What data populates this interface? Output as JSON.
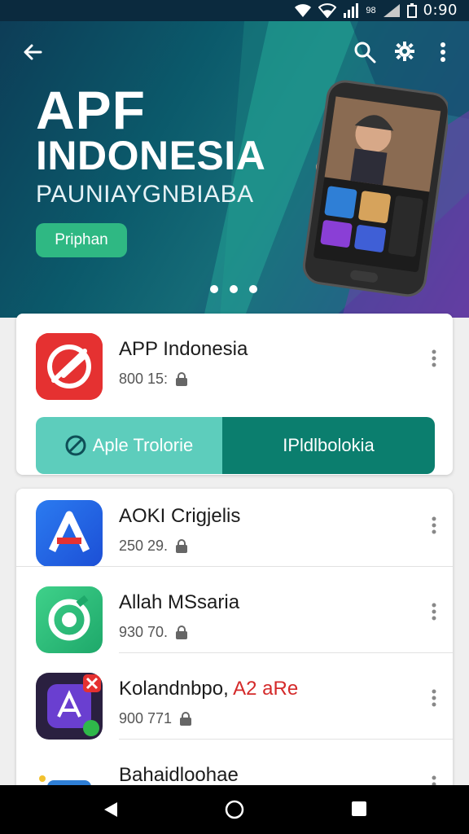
{
  "status_bar": {
    "clock": "0:90",
    "small_label": "98"
  },
  "hero": {
    "title_line1": "APF",
    "title_line2": "INDONESIA",
    "subtitle": "PAUNIAYGNBIABA",
    "cta_label": "Priphan",
    "carousel_dots": 3
  },
  "featured_app": {
    "name": "APP Indonesia",
    "meta": "800 15:",
    "primary_action": "Aple Trolorie",
    "secondary_action": "IPldlbolokia"
  },
  "app_list": [
    {
      "name": "AOKI Crigjelis",
      "meta": "250 29."
    },
    {
      "name": "Allah MSsaria",
      "meta": "930 70."
    },
    {
      "name": "Kolandnbpo,",
      "name_tag": "A2 aRe",
      "meta": "900 771"
    },
    {
      "name": "Bahaidloohae",
      "meta": ""
    }
  ],
  "colors": {
    "accent_green": "#2fb883",
    "action_light": "#5dcdbc",
    "action_dark": "#0b7e6e",
    "tag_red": "#d42a2a"
  }
}
